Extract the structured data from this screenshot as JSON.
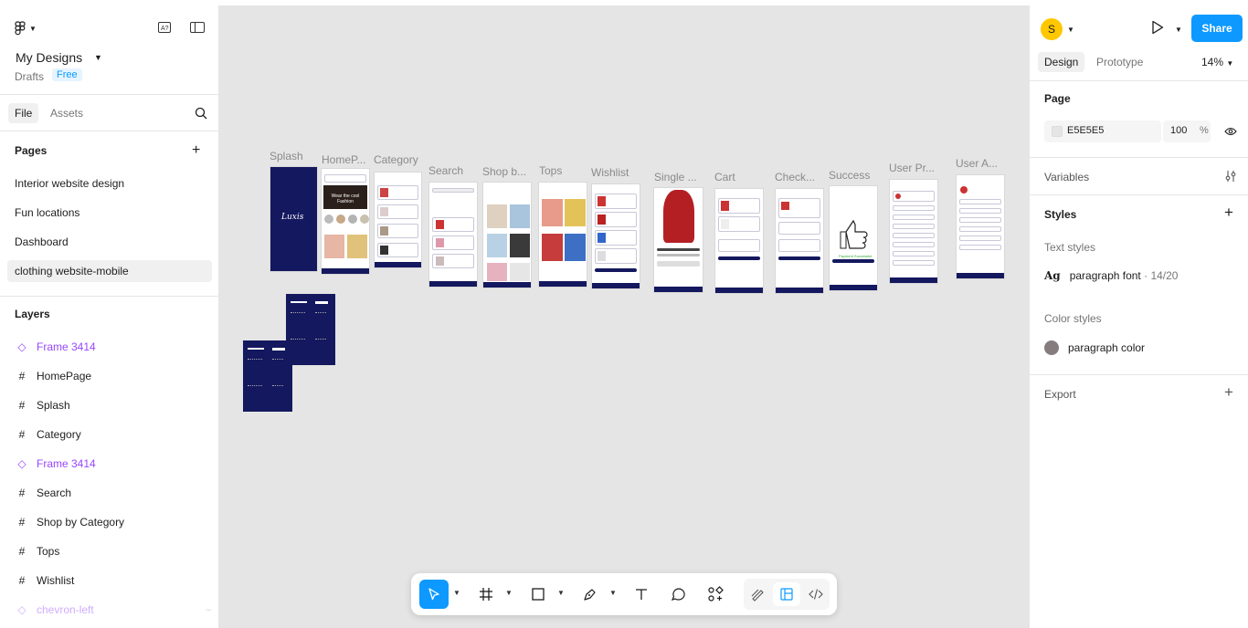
{
  "left": {
    "project_title": "My Designs",
    "drafts_label": "Drafts",
    "plan_badge": "Free",
    "tabs": [
      "File",
      "Assets"
    ],
    "pages_header": "Pages",
    "pages": [
      "Interior website design",
      "Fun locations",
      "Dashboard",
      "clothing website-mobile"
    ],
    "active_page": "clothing website-mobile",
    "layers_header": "Layers",
    "layers": [
      {
        "name": "Frame 3414",
        "kind": "component"
      },
      {
        "name": "HomePage",
        "kind": "frame"
      },
      {
        "name": "Splash",
        "kind": "frame"
      },
      {
        "name": "Category",
        "kind": "frame"
      },
      {
        "name": "Frame 3414",
        "kind": "component"
      },
      {
        "name": "Search",
        "kind": "frame"
      },
      {
        "name": "Shop by Category",
        "kind": "frame"
      },
      {
        "name": "Tops",
        "kind": "frame"
      },
      {
        "name": "Wishlist",
        "kind": "frame"
      },
      {
        "name": "chevron-left",
        "kind": "component"
      }
    ]
  },
  "canvas": {
    "background": "#E5E5E5",
    "frames": [
      "Splash",
      "HomeP...",
      "Category",
      "Search",
      "Shop b...",
      "Tops",
      "Wishlist",
      "Single ...",
      "Cart",
      "Check...",
      "Success",
      "User Pr...",
      "User A..."
    ],
    "splash_brand": "Luxis",
    "home_banner": "Wear the cool Fashion"
  },
  "toolbar": {
    "tools": [
      "move-tool",
      "frame-tool",
      "shape-tool",
      "pen-tool",
      "text-tool",
      "comment-tool",
      "actions-tool",
      "draw-mode",
      "design-mode",
      "dev-mode"
    ]
  },
  "right": {
    "avatar_letter": "S",
    "share_label": "Share",
    "tabs": [
      "Design",
      "Prototype"
    ],
    "zoom": "14%",
    "page_section": "Page",
    "page_color": "E5E5E5",
    "page_opacity": "100",
    "percent_sign": "%",
    "variables_label": "Variables",
    "styles_label": "Styles",
    "text_styles_label": "Text styles",
    "text_style_name": "paragraph font",
    "text_style_meta": "· 14/20",
    "color_styles_label": "Color styles",
    "color_style_name": "paragraph color",
    "color_style_value": "#857D7D",
    "export_label": "Export"
  },
  "help_label": "?"
}
